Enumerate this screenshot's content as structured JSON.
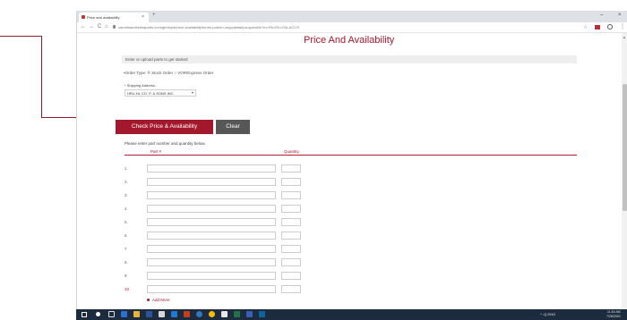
{
  "browser": {
    "tab_title": "Price and availability",
    "tab_close": "×",
    "new_tab": "+",
    "url": "carrollsandestinaparts.com/gtmb/pa/price-availability/forms-pub/en-us/ppdetail/pa-spanish/?m=PA-EN-USA-ACCS",
    "win_minimize": "–",
    "win_close": "×",
    "nav_back": "←",
    "nav_forward": "→",
    "nav_reload": "C",
    "nav_home": "⌂",
    "bookmark": "☆",
    "menu": "⋮"
  },
  "page": {
    "title": "Price And Availability",
    "upload_text": "Enter or upload parts to get started",
    "order_type": "•Order Type: ® Stock Order ○ VOR/Express Order",
    "shipping_label_req": "* ",
    "shipping_label": "Shipping Address:",
    "shipping_value": "HRU HL CO. P. & SONS INC.",
    "shipping_chevron": "▾",
    "check_button": "Check Price & Availability",
    "clear_button": "Clear",
    "instructions": "Please enter part number and quantity below.",
    "col_part": "Part #",
    "col_qty": "Quantity",
    "rows": [
      "1.",
      "2.",
      "3.",
      "4.",
      "5.",
      "6.",
      "7.",
      "8.",
      "9.",
      "10."
    ],
    "add_more": "Add More"
  },
  "taskbar": {
    "tray": "^ ◁) ENG",
    "time": "11:54 AM",
    "date": "7/28/2020"
  },
  "colors": {
    "brand": "#a3182d",
    "secondary_button": "#575757"
  }
}
